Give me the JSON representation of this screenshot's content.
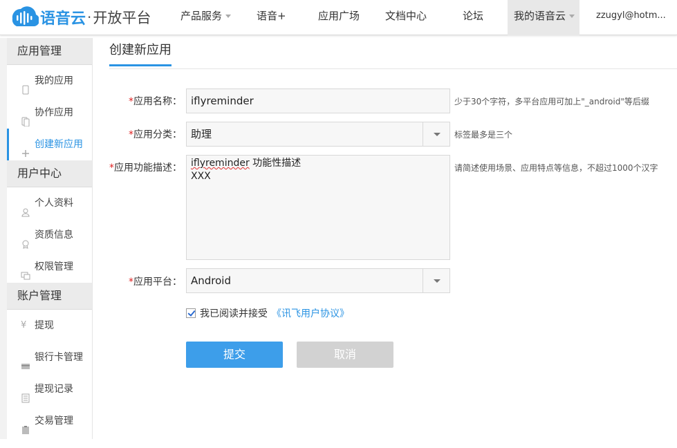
{
  "header": {
    "brand": "语音云",
    "brand_separator": "·",
    "brand_sub": "开放平台",
    "nav": [
      {
        "label": "产品服务",
        "has_caret": true
      },
      {
        "label": "语音+",
        "has_caret": false
      },
      {
        "label": "应用广场",
        "has_caret": false
      },
      {
        "label": "文档中心",
        "has_caret": false
      },
      {
        "label": "论坛",
        "has_caret": false
      },
      {
        "label": "我的语音云",
        "has_caret": true,
        "active": true
      }
    ],
    "user": "zzugyl@hotm..."
  },
  "sidebar": {
    "groups": [
      {
        "title": "应用管理",
        "items": [
          {
            "label": "我的应用",
            "icon": "phone-icon"
          },
          {
            "label": "协作应用",
            "icon": "phones-icon"
          },
          {
            "label": "创建新应用",
            "icon": "plus-icon",
            "active": true
          }
        ]
      },
      {
        "title": "用户中心",
        "items": [
          {
            "label": "个人资料",
            "icon": "user-icon"
          },
          {
            "label": "资质信息",
            "icon": "badge-icon"
          },
          {
            "label": "权限管理",
            "icon": "monitor-icon"
          }
        ]
      },
      {
        "title": "账户管理",
        "items": [
          {
            "label": "提现",
            "icon": "yen-icon"
          },
          {
            "label": "银行卡管理",
            "icon": "card-icon"
          },
          {
            "label": "提现记录",
            "icon": "list-icon"
          },
          {
            "label": "交易管理",
            "icon": "clipboard-icon"
          }
        ]
      }
    ]
  },
  "main": {
    "tab": "创建新应用",
    "form": {
      "required_mark": "*",
      "name_label": "应用名称：",
      "name_value": "iflyreminder",
      "name_hint": "少于30个字符，多平台应用可加上\"_android\"等后缀",
      "category_label": "应用分类：",
      "category_value": "助理",
      "category_hint": "标签最多是三个",
      "desc_label": "应用功能描述：",
      "desc_word": "iflyreminder",
      "desc_rest": " 功能性描述",
      "desc_line2": "XXX",
      "desc_hint": "请简述使用场景、应用特点等信息，不超过1000个汉字",
      "platform_label": "应用平台：",
      "platform_value": "Android",
      "agree_checked": true,
      "agree_text": "我已阅读并接受",
      "agree_link": "《讯飞用户协议》",
      "submit": "提交",
      "cancel": "取消"
    }
  },
  "colors": {
    "accent": "#2a93e3",
    "submit": "#3d9eea",
    "cancel": "#d2d2d2",
    "required": "#e02020"
  }
}
